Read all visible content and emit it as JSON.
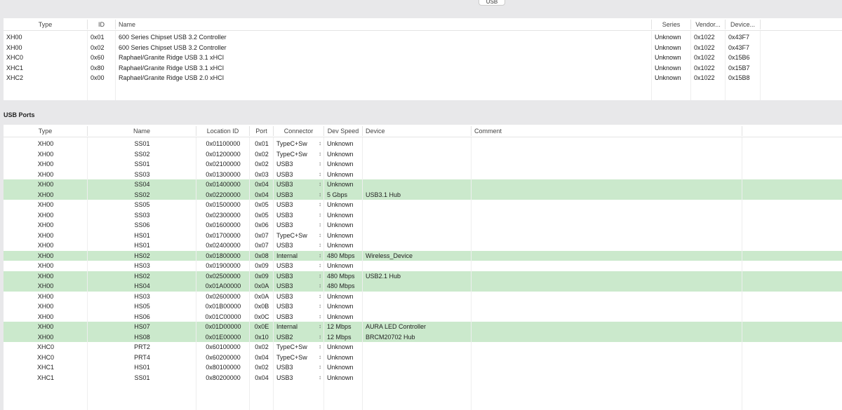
{
  "tab": {
    "label": "USB"
  },
  "controllers": {
    "columns": [
      "Type",
      "ID",
      "Name",
      "Series",
      "Vendor...",
      "Device..."
    ],
    "rows": [
      [
        "XH00",
        "0x01",
        "600 Series Chipset USB 3.2 Controller",
        "Unknown",
        "0x1022",
        "0x43F7"
      ],
      [
        "XH00",
        "0x02",
        "600 Series Chipset USB 3.2 Controller",
        "Unknown",
        "0x1022",
        "0x43F7"
      ],
      [
        "XHC0",
        "0x60",
        "Raphael/Granite Ridge USB 3.1 xHCI",
        "Unknown",
        "0x1022",
        "0x15B6"
      ],
      [
        "XHC1",
        "0x80",
        "Raphael/Granite Ridge USB 3.1 xHCI",
        "Unknown",
        "0x1022",
        "0x15B7"
      ],
      [
        "XHC2",
        "0x00",
        "Raphael/Granite Ridge USB 2.0 xHCI",
        "Unknown",
        "0x1022",
        "0x15B8"
      ]
    ]
  },
  "ports": {
    "title": "USB Ports",
    "columns": [
      "Type",
      "Name",
      "Location ID",
      "Port",
      "Connector",
      "Dev Speed",
      "Device",
      "Comment"
    ],
    "highlight_color": "#cbe9cc",
    "rows": [
      {
        "type": "XH00",
        "name": "SS01",
        "loc": "0x01100000",
        "port": "0x01",
        "conn": "TypeC+Sw",
        "speed": "Unknown",
        "device": "",
        "comment": "",
        "active": false
      },
      {
        "type": "XH00",
        "name": "SS02",
        "loc": "0x01200000",
        "port": "0x02",
        "conn": "TypeC+Sw",
        "speed": "Unknown",
        "device": "",
        "comment": "",
        "active": false
      },
      {
        "type": "XH00",
        "name": "SS01",
        "loc": "0x02100000",
        "port": "0x02",
        "conn": "USB3",
        "speed": "Unknown",
        "device": "",
        "comment": "",
        "active": false
      },
      {
        "type": "XH00",
        "name": "SS03",
        "loc": "0x01300000",
        "port": "0x03",
        "conn": "USB3",
        "speed": "Unknown",
        "device": "",
        "comment": "",
        "active": false
      },
      {
        "type": "XH00",
        "name": "SS04",
        "loc": "0x01400000",
        "port": "0x04",
        "conn": "USB3",
        "speed": "Unknown",
        "device": "",
        "comment": "",
        "active": true
      },
      {
        "type": "XH00",
        "name": "SS02",
        "loc": "0x02200000",
        "port": "0x04",
        "conn": "USB3",
        "speed": "5 Gbps",
        "device": "USB3.1 Hub",
        "comment": "",
        "active": true
      },
      {
        "type": "XH00",
        "name": "SS05",
        "loc": "0x01500000",
        "port": "0x05",
        "conn": "USB3",
        "speed": "Unknown",
        "device": "",
        "comment": "",
        "active": false
      },
      {
        "type": "XH00",
        "name": "SS03",
        "loc": "0x02300000",
        "port": "0x05",
        "conn": "USB3",
        "speed": "Unknown",
        "device": "",
        "comment": "",
        "active": false
      },
      {
        "type": "XH00",
        "name": "SS06",
        "loc": "0x01600000",
        "port": "0x06",
        "conn": "USB3",
        "speed": "Unknown",
        "device": "",
        "comment": "",
        "active": false
      },
      {
        "type": "XH00",
        "name": "HS01",
        "loc": "0x01700000",
        "port": "0x07",
        "conn": "TypeC+Sw",
        "speed": "Unknown",
        "device": "",
        "comment": "",
        "active": false
      },
      {
        "type": "XH00",
        "name": "HS01",
        "loc": "0x02400000",
        "port": "0x07",
        "conn": "USB3",
        "speed": "Unknown",
        "device": "",
        "comment": "",
        "active": false
      },
      {
        "type": "XH00",
        "name": "HS02",
        "loc": "0x01800000",
        "port": "0x08",
        "conn": "Internal",
        "speed": "480 Mbps",
        "device": "Wireless_Device",
        "comment": "",
        "active": true
      },
      {
        "type": "XH00",
        "name": "HS03",
        "loc": "0x01900000",
        "port": "0x09",
        "conn": "USB3",
        "speed": "Unknown",
        "device": "",
        "comment": "",
        "active": false
      },
      {
        "type": "XH00",
        "name": "HS02",
        "loc": "0x02500000",
        "port": "0x09",
        "conn": "USB3",
        "speed": "480 Mbps",
        "device": "USB2.1 Hub",
        "comment": "",
        "active": true
      },
      {
        "type": "XH00",
        "name": "HS04",
        "loc": "0x01A00000",
        "port": "0x0A",
        "conn": "USB3",
        "speed": "480 Mbps",
        "device": "",
        "comment": "",
        "active": true
      },
      {
        "type": "XH00",
        "name": "HS03",
        "loc": "0x02600000",
        "port": "0x0A",
        "conn": "USB3",
        "speed": "Unknown",
        "device": "",
        "comment": "",
        "active": false
      },
      {
        "type": "XH00",
        "name": "HS05",
        "loc": "0x01B00000",
        "port": "0x0B",
        "conn": "USB3",
        "speed": "Unknown",
        "device": "",
        "comment": "",
        "active": false
      },
      {
        "type": "XH00",
        "name": "HS06",
        "loc": "0x01C00000",
        "port": "0x0C",
        "conn": "USB3",
        "speed": "Unknown",
        "device": "",
        "comment": "",
        "active": false
      },
      {
        "type": "XH00",
        "name": "HS07",
        "loc": "0x01D00000",
        "port": "0x0E",
        "conn": "Internal",
        "speed": "12 Mbps",
        "device": "AURA LED Controller",
        "comment": "",
        "active": true
      },
      {
        "type": "XH00",
        "name": "HS08",
        "loc": "0x01E00000",
        "port": "0x10",
        "conn": "USB2",
        "speed": "12 Mbps",
        "device": "BRCM20702 Hub",
        "comment": "",
        "active": true
      },
      {
        "type": "XHC0",
        "name": "PRT2",
        "loc": "0x60100000",
        "port": "0x02",
        "conn": "TypeC+Sw",
        "speed": "Unknown",
        "device": "",
        "comment": "",
        "active": false
      },
      {
        "type": "XHC0",
        "name": "PRT4",
        "loc": "0x60200000",
        "port": "0x04",
        "conn": "TypeC+Sw",
        "speed": "Unknown",
        "device": "",
        "comment": "",
        "active": false
      },
      {
        "type": "XHC1",
        "name": "HS01",
        "loc": "0x80100000",
        "port": "0x02",
        "conn": "USB3",
        "speed": "Unknown",
        "device": "",
        "comment": "",
        "active": false
      },
      {
        "type": "XHC1",
        "name": "SS01",
        "loc": "0x80200000",
        "port": "0x04",
        "conn": "USB3",
        "speed": "Unknown",
        "device": "",
        "comment": "",
        "active": false
      }
    ]
  }
}
